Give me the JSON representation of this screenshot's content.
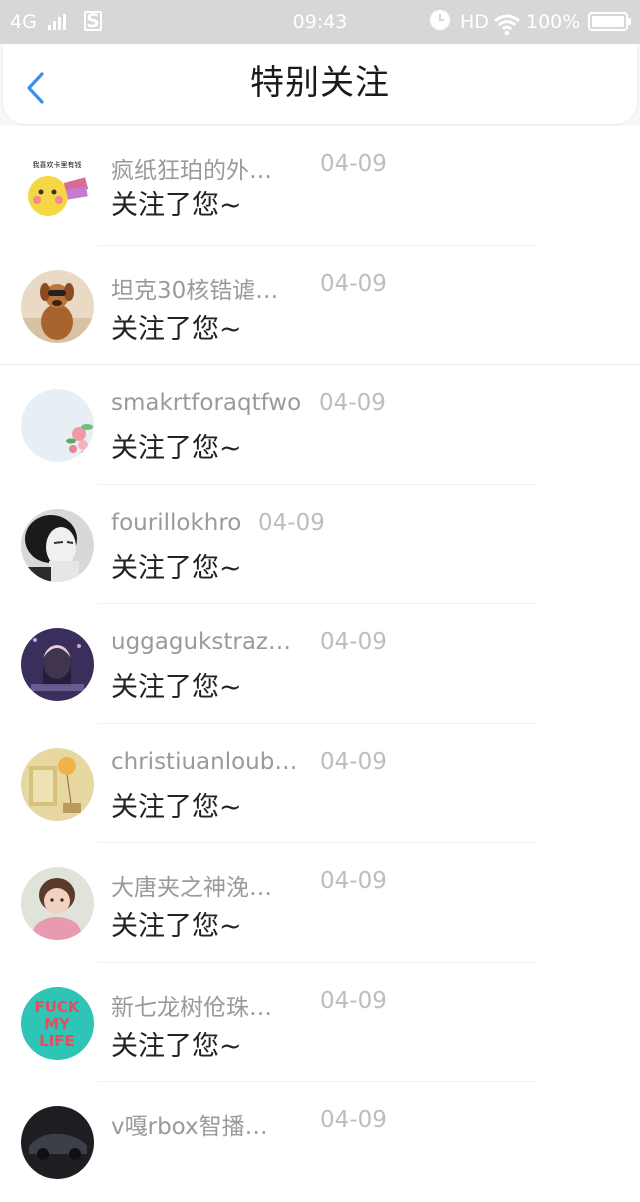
{
  "status_bar": {
    "network": "4G",
    "sim_badge": "S",
    "time": "09:43",
    "hd": "HD",
    "battery": "100%"
  },
  "header": {
    "title": "特别关注",
    "back_icon": "chevron-left-icon"
  },
  "items": [
    {
      "name": "疯纸狂珀的外…",
      "time": "04-09",
      "message": "关注了您~",
      "avatar_icon": "emoji-avatar",
      "avatar_caption": "我喜欢卡里有钱"
    },
    {
      "name": "坦克30核锆谑…",
      "time": "04-09",
      "message": "关注了您~",
      "avatar_icon": "dog-avatar"
    },
    {
      "name": "smakrtforaqtfwo",
      "time": "04-09",
      "message": "关注了您~",
      "avatar_icon": "flower-avatar"
    },
    {
      "name": "fourillokhro",
      "time": "04-09",
      "message": "关注了您~",
      "avatar_icon": "man-portrait-avatar"
    },
    {
      "name": "uggagukstraz…",
      "time": "04-09",
      "message": "关注了您~",
      "avatar_icon": "girl-night-avatar"
    },
    {
      "name": "christiuanloub…",
      "time": "04-09",
      "message": "关注了您~",
      "avatar_icon": "balloon-room-avatar"
    },
    {
      "name": "大唐夹之神浼…",
      "time": "04-09",
      "message": "关注了您~",
      "avatar_icon": "child-avatar"
    },
    {
      "name": "新七龙树伧珠…",
      "time": "04-09",
      "message": "关注了您~",
      "avatar_icon": "text-logo-avatar",
      "avatar_text": [
        "FUCK",
        "MY",
        "LIFE"
      ]
    },
    {
      "name": "v嘎rbox智播…",
      "time": "04-09",
      "message": "",
      "avatar_icon": "car-avatar"
    }
  ],
  "colors": {
    "accent": "#3a8ef0",
    "status_bar_bg": "#d7d7d7",
    "name_text": "#9a9a9a",
    "time_text": "#bdbdbd"
  }
}
